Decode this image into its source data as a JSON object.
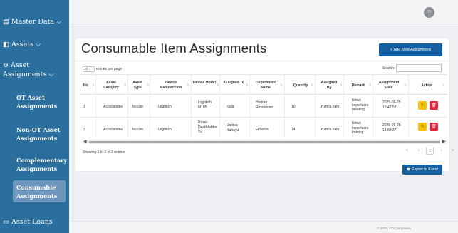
{
  "sidebar": {
    "master_data": "Master Data",
    "assets": "Assets",
    "asset_assignments": "Asset Assignments",
    "ot_asset_assignments": "OT Asset Assignments",
    "non_ot_asset_assignments": "Non-OT Asset Assignments",
    "complementary_assignments": "Complementary Assignments",
    "consumable_assignments": "Consumable Assignments",
    "asset_loans": "Asset Loans"
  },
  "header": {
    "avatar_initials": "YI"
  },
  "page": {
    "title": "Consumable Item Assignments",
    "add_button": "+ Add New Assignment",
    "entries_value": "10",
    "entries_suffix": "entries per page",
    "search_label": "Search:",
    "search_value": "",
    "showing": "Showing 1 to 2 of 2 entries",
    "export_button": "Export to Excel"
  },
  "table": {
    "columns": [
      "No.",
      "Asset Category",
      "Asset Type",
      "Device Manufacturer",
      "Device Model",
      "Assigned To",
      "Department Name",
      "Quantity",
      "Assigned By",
      "Remark",
      "Assignment Date",
      "Action"
    ],
    "rows": [
      [
        "1",
        "Accessories",
        "Mouse",
        "Logitech",
        "Logitech M185",
        "Iusia",
        "Human Resources",
        "10",
        "Yumna Ilahi",
        "Untuk keperluan meeting",
        "2025-06-25 10:42:58"
      ],
      [
        "2",
        "Accessories",
        "Mouse",
        "Logitech",
        "Razer DeathAdder V2",
        "Danisa Rahayu",
        "Finance",
        "14",
        "Yumna Ilahi",
        "Untuk keperluan training",
        "2025-06-25 14:58:37"
      ]
    ]
  },
  "pagination": {
    "first": "«",
    "prev": "‹",
    "current": "1",
    "next": "›",
    "last": "»"
  },
  "footer": {
    "text": "© 2025, YTI Companies"
  },
  "colors": {
    "sidebar": "#2b6f9e",
    "primary": "#155fa0",
    "edit": "#f4c20d",
    "delete": "#e0263a"
  }
}
